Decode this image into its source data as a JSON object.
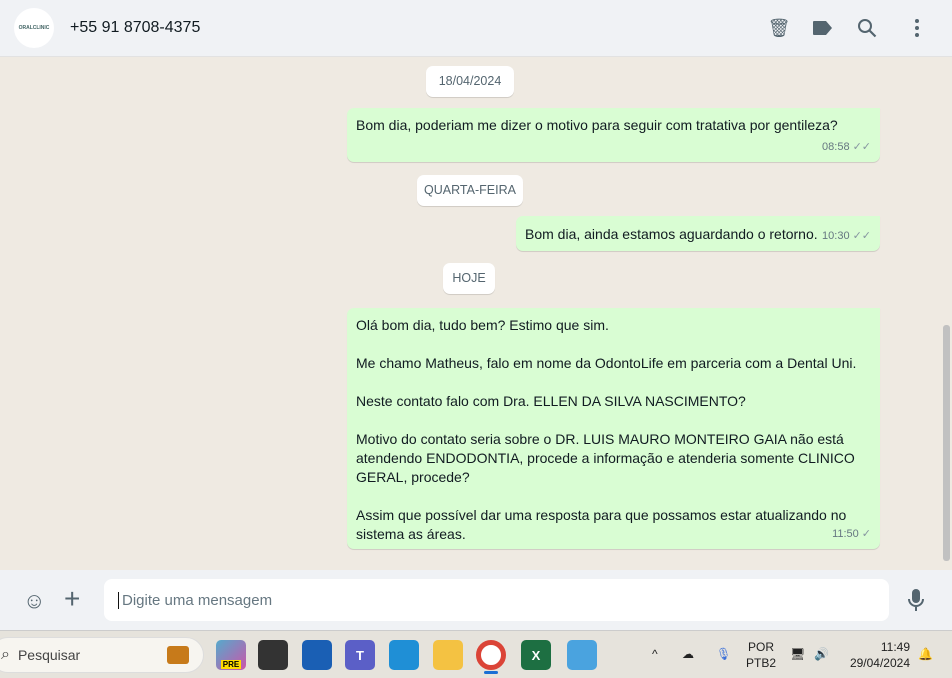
{
  "header": {
    "contact": "+55 91 8708-4375",
    "avatar_text": "ORALCLINIC",
    "icons": [
      "delete-icon",
      "label-icon",
      "search-icon",
      "menu-icon"
    ]
  },
  "messages": [
    {
      "type": "date",
      "text": "18/04/2024"
    },
    {
      "type": "out",
      "paragraphs": [
        "Bom dia, poderiam me dizer o motivo para seguir com tratativa por gentileza?"
      ],
      "time": "08:58",
      "status": "read-double-tick"
    },
    {
      "type": "date",
      "text": "QUARTA-FEIRA"
    },
    {
      "type": "out",
      "paragraphs": [
        "Bom dia, ainda estamos aguardando o retorno."
      ],
      "time": "10:30",
      "status": "read-double-tick"
    },
    {
      "type": "date",
      "text": "HOJE"
    },
    {
      "type": "out",
      "paragraphs": [
        "Olá bom dia, tudo bem? Estimo que sim.",
        "Me chamo Matheus, falo em nome da OdontoLife em parceria com a Dental Uni.",
        "Neste contato falo com Dra. ELLEN DA SILVA NASCIMENTO?",
        "Motivo do contato seria sobre o DR. LUIS MAURO MONTEIRO GAIA não está atendendo ENDODONTIA, procede a informação e atenderia somente CLINICO GERAL, procede?",
        "Assim que possível dar uma resposta para que possamos estar atualizando no sistema as áreas."
      ],
      "time": "11:50",
      "status": "sent-single-tick"
    }
  ],
  "composer": {
    "placeholder": "Digite uma mensagem"
  },
  "taskbar": {
    "search": "Pesquisar",
    "lang1": "POR",
    "lang2": "PTB2",
    "time": "11:49",
    "date": "29/04/2024",
    "pre_badge": "PRE"
  }
}
